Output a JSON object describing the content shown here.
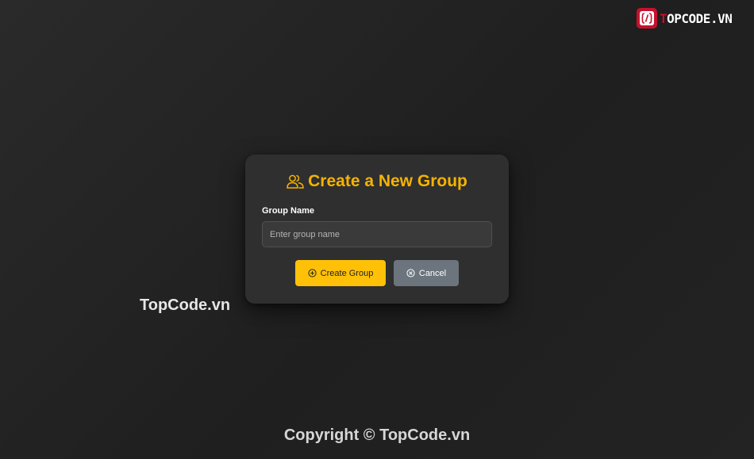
{
  "logo": {
    "prefix": "T",
    "text": "OPCODE.VN",
    "icon": "topcode-logo-icon",
    "brand_color": "#c8102e"
  },
  "watermark": "TopCode.vn",
  "dialog": {
    "title": "Create a New Group",
    "title_icon": "users-icon",
    "field_label": "Group Name",
    "field_placeholder": "Enter group name",
    "field_value": "",
    "create_label": "Create Group",
    "create_icon": "plus-circle-icon",
    "cancel_label": "Cancel",
    "cancel_icon": "x-circle-icon",
    "accent_color": "#f5b301",
    "primary_button_color": "#ffc107",
    "secondary_button_color": "#6c757d"
  },
  "footer": {
    "copyright": "Copyright © TopCode.vn"
  }
}
